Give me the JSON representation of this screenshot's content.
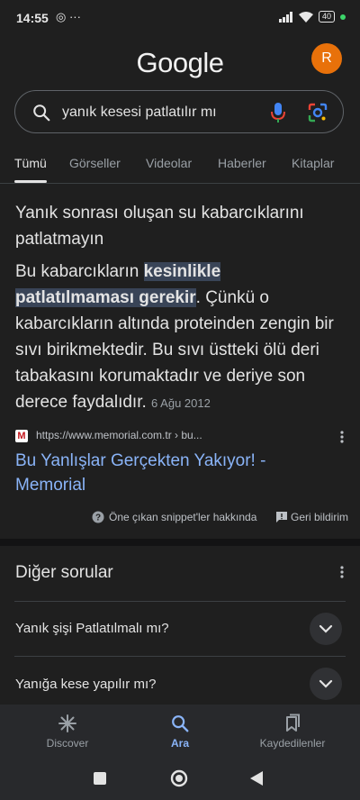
{
  "status_bar": {
    "time": "14:55",
    "left_icons": "◎ ···",
    "battery": "40"
  },
  "header": {
    "logo": "Google",
    "avatar_letter": "R"
  },
  "search": {
    "query": "yanık kesesi patlatılır mı"
  },
  "tabs": [
    {
      "label": "Tümü",
      "active": true
    },
    {
      "label": "Görseller"
    },
    {
      "label": "Videolar"
    },
    {
      "label": "Haberler"
    },
    {
      "label": "Kitaplar"
    }
  ],
  "snippet": {
    "heading": "Yanık sonrası oluşan su kabarcıklarını patlatmayın",
    "body_pre": "Bu kabarcıkların ",
    "body_highlight": "kesinlikle patlatılmaması gerekir",
    "body_post": ". Çünkü o kabarcıkların altında proteinden zengin bir sıvı birikmektedir. Bu sıvı üstteki ölü deri tabakasını korumaktadır ve deriye son derece faydalıdır.",
    "date": "6 Ağu 2012",
    "source_favicon": "M",
    "source_url": "https://www.memorial.com.tr › bu...",
    "source_title": "Bu Yanlışlar Gerçekten Yakıyor! - Memorial",
    "about_label": "Öne çıkan snippet'ler hakkında",
    "feedback_label": "Geri bildirim"
  },
  "paa": {
    "title": "Diğer sorular",
    "questions": [
      "Yanık şişi Patlatılmalı mı?",
      "Yanığa kese yapılır mı?"
    ]
  },
  "bottom_nav": {
    "discover": "Discover",
    "search": "Ara",
    "saved": "Kaydedilenler"
  },
  "colors": {
    "background": "#1f1f1f",
    "link": "#8ab4f8",
    "avatar": "#e8710a",
    "highlight": "#394457"
  }
}
